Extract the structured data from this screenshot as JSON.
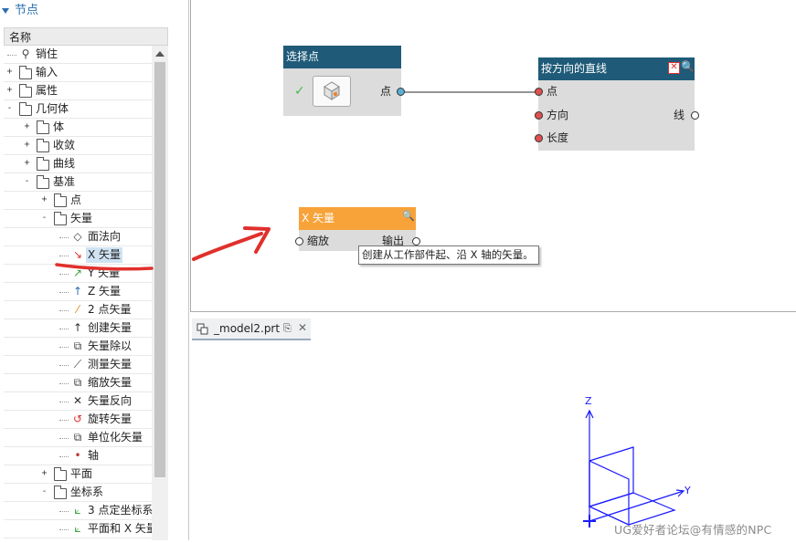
{
  "panel": {
    "title": "节点",
    "column_header": "名称"
  },
  "tree": [
    {
      "label": "销住",
      "icon": "pin-icon",
      "expander": ""
    },
    {
      "label": "输入",
      "icon": "folder-icon",
      "expander": "+"
    },
    {
      "label": "属性",
      "icon": "folder-icon",
      "expander": "+"
    },
    {
      "label": "几何体",
      "icon": "folder-icon",
      "expander": "-"
    },
    {
      "label": "体",
      "icon": "folder-icon",
      "expander": "+"
    },
    {
      "label": "收敛",
      "icon": "folder-icon",
      "expander": "+"
    },
    {
      "label": "曲线",
      "icon": "folder-icon",
      "expander": "+"
    },
    {
      "label": "基准",
      "icon": "folder-icon",
      "expander": "-"
    },
    {
      "label": "点",
      "icon": "folder-icon",
      "expander": "+"
    },
    {
      "label": "矢量",
      "icon": "folder-icon",
      "expander": "-"
    },
    {
      "label": "面法向",
      "icon": "face-normal-icon",
      "expander": ""
    },
    {
      "label": "X 矢量",
      "icon": "x-vector-icon",
      "expander": ""
    },
    {
      "label": "Y 矢量",
      "icon": "y-vector-icon",
      "expander": ""
    },
    {
      "label": "Z 矢量",
      "icon": "z-vector-icon",
      "expander": ""
    },
    {
      "label": "2 点矢量",
      "icon": "two-point-vector-icon",
      "expander": ""
    },
    {
      "label": "创建矢量",
      "icon": "create-vector-icon",
      "expander": ""
    },
    {
      "label": "矢量除以",
      "icon": "vector-divide-icon",
      "expander": ""
    },
    {
      "label": "测量矢量",
      "icon": "measure-vector-icon",
      "expander": ""
    },
    {
      "label": "缩放矢量",
      "icon": "scale-vector-icon",
      "expander": ""
    },
    {
      "label": "矢量反向",
      "icon": "reverse-vector-icon",
      "expander": ""
    },
    {
      "label": "旋转矢量",
      "icon": "rotate-vector-icon",
      "expander": ""
    },
    {
      "label": "单位化矢量",
      "icon": "unitize-vector-icon",
      "expander": ""
    },
    {
      "label": "轴",
      "icon": "axis-icon",
      "expander": ""
    },
    {
      "label": "平面",
      "icon": "folder-icon",
      "expander": "+"
    },
    {
      "label": "坐标系",
      "icon": "folder-icon",
      "expander": "-"
    },
    {
      "label": "3 点定坐标系",
      "icon": "csys-3point-icon",
      "expander": ""
    },
    {
      "label": "平面和 X 矢量",
      "icon": "csys-plane-x-icon",
      "expander": ""
    }
  ],
  "nodes": {
    "select_point": {
      "title": "选择点",
      "output": "点",
      "header_color": "#1f5b78"
    },
    "line_along_direction": {
      "title": "按方向的直线",
      "inputs": [
        "点",
        "方向",
        "长度"
      ],
      "output": "线",
      "header_color": "#1f5b78"
    },
    "x_vector": {
      "title": "X 矢量",
      "input": "缩放",
      "output": "输出",
      "header_color": "#f7a33a"
    }
  },
  "tooltip": "创建从工作部件起、沿 X 轴的矢量。",
  "model_tab": {
    "label": "_model2.prt"
  },
  "axes": {
    "z": "Z",
    "y": "Y"
  },
  "watermark": "UG爱好者论坛@有情感的NPC",
  "colors": {
    "accent": "#2a6fb0",
    "port_input": "#e05050",
    "port_output": "#5aaed6",
    "annotation": "#e0302c",
    "axis": "#1a1aff"
  }
}
